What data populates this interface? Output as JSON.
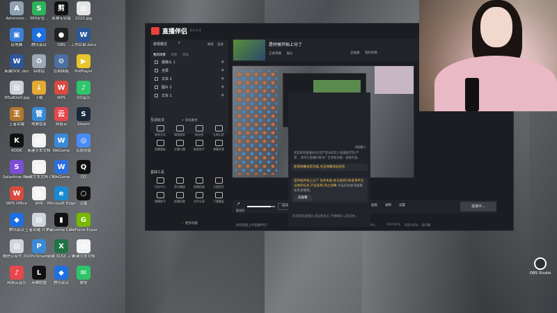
{
  "desktop_icons": [
    {
      "label": "Administr...",
      "color": "#8fa2b4",
      "glyph": "A"
    },
    {
      "label": "360安全...",
      "color": "#2fb35a",
      "glyph": "S"
    },
    {
      "label": "剪映专业版",
      "color": "#111111",
      "glyph": "剪"
    },
    {
      "label": "2222.jpg",
      "color": "#e4e4e4",
      "glyph": "▤"
    },
    {
      "label": "此电脑",
      "color": "#3c7fd8",
      "glyph": "▣"
    },
    {
      "label": "腾讯会议",
      "color": "#1f6fe0",
      "glyph": "◆"
    },
    {
      "label": "OBS",
      "color": "#222222",
      "glyph": "●"
    },
    {
      "label": "工作目录.docx",
      "color": "#2b579a",
      "glyph": "W"
    },
    {
      "label": "新建DOC.doc",
      "color": "#2b579a",
      "glyph": "W"
    },
    {
      "label": "回收站",
      "color": "#9aa7b4",
      "glyph": "♻"
    },
    {
      "label": "控制面板",
      "color": "#4c6fa1",
      "glyph": "⚙"
    },
    {
      "label": "PotPlayer",
      "color": "#e7c52b",
      "glyph": "▶"
    },
    {
      "label": "3f5a82e0.jpg",
      "color": "#cdd2d8",
      "glyph": "▤"
    },
    {
      "label": "下载",
      "color": "#e5a935",
      "glyph": "↓"
    },
    {
      "label": "WPS",
      "color": "#d84b3f",
      "glyph": "W"
    },
    {
      "label": "QQ音乐",
      "color": "#2ec56a",
      "glyph": "♪"
    },
    {
      "label": "王者荣耀",
      "color": "#b1772d",
      "glyph": "王"
    },
    {
      "label": "电脑管家",
      "color": "#3a8ad8",
      "glyph": "管"
    },
    {
      "label": "网易云",
      "color": "#e5484d",
      "glyph": "云"
    },
    {
      "label": "Steam",
      "color": "#1b2838",
      "glyph": "S"
    },
    {
      "label": "KOOK",
      "color": "#111111",
      "glyph": "K"
    },
    {
      "label": "新建文本文档",
      "color": "#f2f2f2",
      "glyph": "▤"
    },
    {
      "label": "WeGame",
      "color": "#3a8ad8",
      "glyph": "W"
    },
    {
      "label": "百度网盘",
      "color": "#4a8af4",
      "glyph": "◎"
    },
    {
      "label": "Splashtop Business",
      "color": "#7c4ed6",
      "glyph": "S"
    },
    {
      "label": "新建文本文档 (3).txt",
      "color": "#f2f2f2",
      "glyph": "▤"
    },
    {
      "label": "WeGame",
      "color": "#2d6fe0",
      "glyph": "W"
    },
    {
      "label": "QQ",
      "color": "#111111",
      "glyph": "Q"
    },
    {
      "label": "WPS Office",
      "color": "#d84b3f",
      "glyph": "W"
    },
    {
      "label": "WIN",
      "color": "#f2f2f2",
      "glyph": "▤"
    },
    {
      "label": "Microsoft Edge",
      "color": "#1a8ad4",
      "glyph": "e"
    },
    {
      "label": "迅雷",
      "color": "#111111",
      "glyph": "○"
    },
    {
      "label": "腾讯会议",
      "color": "#1f6fe0",
      "glyph": "◆"
    },
    {
      "label": "王者荣耀·开发者",
      "color": "#cfd5dc",
      "glyph": "▤"
    },
    {
      "label": "Focusrite Control",
      "color": "#111111",
      "glyph": "▮"
    },
    {
      "label": "GeForce Experience",
      "color": "#76b900",
      "glyph": "G"
    },
    {
      "label": "微信公众号 2020-01-2...",
      "color": "#cfd5dc",
      "glyph": "▤"
    },
    {
      "label": "PicSmart",
      "color": "#3a8ad8",
      "glyph": "P"
    },
    {
      "label": "新建 XLSX 工作表.xlsx",
      "color": "#217346",
      "glyph": "X"
    },
    {
      "label": "新建文本文档",
      "color": "#f2f2f2",
      "glyph": "▤"
    },
    {
      "label": "网易云音乐",
      "color": "#e5484d",
      "glyph": "♪"
    },
    {
      "label": "英雄联盟",
      "color": "#111111",
      "glyph": "L"
    },
    {
      "label": "腾讯会议",
      "color": "#1f6fe0",
      "glyph": "◆"
    },
    {
      "label": "微信",
      "color": "#2ec56a",
      "glyph": "✉"
    },
    {
      "label": "YY语音",
      "color": "#e7c52b",
      "glyph": "Y"
    },
    {
      "label": "OBS Studio",
      "color": "#303030",
      "glyph": "●"
    }
  ],
  "app": {
    "title": "直播伴侣",
    "version": "6.5.5.4",
    "mode_label": "常规模式",
    "mode_arrow": "▾",
    "mode_side": [
      "横屏",
      "竖屏"
    ],
    "scene_tabs": [
      "我的场景",
      "场景",
      "添加"
    ],
    "scenes": [
      {
        "label": "摄像头 1"
      },
      {
        "label": "全屏"
      },
      {
        "label": "文本 2"
      },
      {
        "label": "图片 2"
      },
      {
        "label": "文本 1"
      }
    ],
    "add_source": "+ 添加素材",
    "interact_title": "互动玩法",
    "interact_tools": [
      "游戏互动",
      "福袋抽奖",
      "粉丝团",
      "礼物心愿",
      "直播看板",
      "主播口播",
      "贴纸助手",
      "弹幕投票"
    ],
    "basic_title": "基础工具",
    "basic_tools": [
      "任务中心",
      "音乐播放",
      "直播回放",
      "正版音乐",
      "弹幕助手",
      "直播间管",
      "文件分享",
      "下播看板"
    ],
    "more_label": "··· 更多功能",
    "stream_title": "是时候开始上分了",
    "stream_tags": [
      "王者荣耀",
      "娱乐"
    ],
    "stats": [
      "全站榜",
      "签约月榜"
    ],
    "start_live": "主播权益",
    "top_link": "开播提醒",
    "toast_text": "这三都分画不再在",
    "mic_label": "麦克风",
    "mic_pct": "85%",
    "speaker_label": "扬声器",
    "speaker_pct": "100%",
    "ctl_labels": [
      "画质",
      "录制",
      "设置"
    ],
    "connect_label": "连接中...",
    "status": [
      "如何快速上手直播伴侣?",
      "码率0Kb/s",
      "FPS:0",
      "丢帧:0(0.00%)",
      "CPU:34%",
      "内存:63%",
      "未开播"
    ],
    "chat_count": "0观看人",
    "chat_hint": "欢迎来到直播间!抖音严禁未成年人直播或打赏,严禁... 请勿在直播间发布广告或者违规、低俗内容。",
    "chat_msg1": "新增弹幕语音功能,点击弹幕添加语音",
    "chat_msg2_a": "是时候开始上分了 任务失败,你已收到1条星海平台派发的任务,产品名称:风之剑舞",
    "chat_msg2_b": "点击前往星海查看任务详情吧。",
    "chat_view_btn": "去查看",
    "chat_input_hint": "欢迎来到直播间,请友善发言,不要刷屏 以及其他...",
    "camera_time": "11"
  },
  "obs_label": "OBS Studio"
}
